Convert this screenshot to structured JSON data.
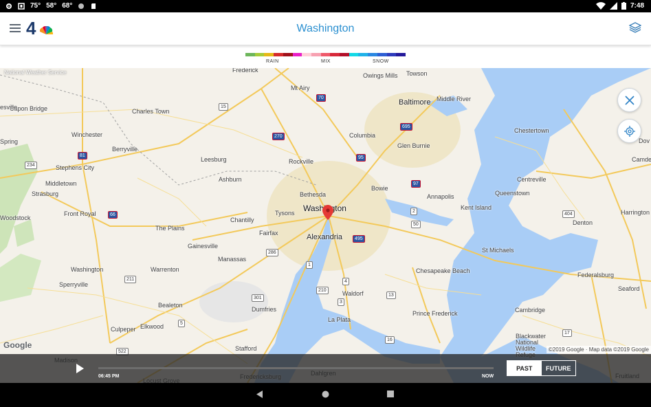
{
  "status_bar": {
    "temps": [
      "75°",
      "58°",
      "68°"
    ],
    "time": "7:48"
  },
  "app_bar": {
    "title": "Washington",
    "logo_text": "4"
  },
  "legend": {
    "labels": [
      "RAIN",
      "MIX",
      "SNOW"
    ],
    "colors": [
      "#6db65b",
      "#a6cc3a",
      "#e6b917",
      "#d52b2b",
      "#a1111b",
      "#e91ec8",
      "#ffd0d8",
      "#f7a1b1",
      "#ef5a6b",
      "#d72839",
      "#b3102a",
      "#12d9e6",
      "#1fb2e8",
      "#2a88e2",
      "#2d5fd4",
      "#2e3cbc",
      "#241a9b"
    ]
  },
  "map": {
    "source_label": "National Weather Service",
    "google_label": "Google",
    "attribution": "©2019 Google · Map data ©2019 Google",
    "places": [
      {
        "name": "Frederick",
        "cls": ""
      },
      {
        "name": "Towson",
        "cls": ""
      },
      {
        "name": "Owings Mills",
        "cls": ""
      },
      {
        "name": "Mt Airy",
        "cls": ""
      },
      {
        "name": "Baltimore",
        "cls": "big"
      },
      {
        "name": "Middle River",
        "cls": ""
      },
      {
        "name": "Capon Bridge",
        "cls": ""
      },
      {
        "name": "Charles Town",
        "cls": ""
      },
      {
        "name": "Chestertown",
        "cls": ""
      },
      {
        "name": "Winchester",
        "cls": ""
      },
      {
        "name": "Columbia",
        "cls": ""
      },
      {
        "name": "Glen Burnie",
        "cls": ""
      },
      {
        "name": "Berryville",
        "cls": ""
      },
      {
        "name": "Leesburg",
        "cls": ""
      },
      {
        "name": "Rockville",
        "cls": ""
      },
      {
        "name": "Stephens City",
        "cls": ""
      },
      {
        "name": "Middletown",
        "cls": ""
      },
      {
        "name": "Ashburn",
        "cls": ""
      },
      {
        "name": "Bowie",
        "cls": ""
      },
      {
        "name": "Centreville",
        "cls": ""
      },
      {
        "name": "Strasburg",
        "cls": ""
      },
      {
        "name": "Bethesda",
        "cls": ""
      },
      {
        "name": "Annapolis",
        "cls": ""
      },
      {
        "name": "Queenstown",
        "cls": ""
      },
      {
        "name": "Washington",
        "cls": "big2"
      },
      {
        "name": "Kent Island",
        "cls": ""
      },
      {
        "name": "Front Royal",
        "cls": ""
      },
      {
        "name": "Tysons",
        "cls": ""
      },
      {
        "name": "Chantilly",
        "cls": ""
      },
      {
        "name": "Denton",
        "cls": ""
      },
      {
        "name": "Harrington",
        "cls": ""
      },
      {
        "name": "Woodstock",
        "cls": ""
      },
      {
        "name": "The Plains",
        "cls": ""
      },
      {
        "name": "Fairfax",
        "cls": ""
      },
      {
        "name": "Alexandria",
        "cls": "big"
      },
      {
        "name": "Gainesville",
        "cls": ""
      },
      {
        "name": "St Michaels",
        "cls": ""
      },
      {
        "name": "Manassas",
        "cls": ""
      },
      {
        "name": "Washington",
        "cls": ""
      },
      {
        "name": "Warrenton",
        "cls": ""
      },
      {
        "name": "Chesapeake Beach",
        "cls": ""
      },
      {
        "name": "Federalsburg",
        "cls": ""
      },
      {
        "name": "Sperryville",
        "cls": ""
      },
      {
        "name": "Waldorf",
        "cls": ""
      },
      {
        "name": "Seaford",
        "cls": ""
      },
      {
        "name": "Bealeton",
        "cls": ""
      },
      {
        "name": "Dumfries",
        "cls": ""
      },
      {
        "name": "Cambridge",
        "cls": ""
      },
      {
        "name": "Prince Frederick",
        "cls": ""
      },
      {
        "name": "La Plata",
        "cls": ""
      },
      {
        "name": "Elkwood",
        "cls": ""
      },
      {
        "name": "Culpeper",
        "cls": ""
      },
      {
        "name": "Blackwater National Wildlife Refuge",
        "cls": ""
      },
      {
        "name": "Stafford",
        "cls": ""
      },
      {
        "name": "Madison",
        "cls": ""
      },
      {
        "name": "Locust Grove",
        "cls": ""
      },
      {
        "name": "Fredericksburg",
        "cls": ""
      },
      {
        "name": "Dahlgren",
        "cls": ""
      },
      {
        "name": "Fruitland",
        "cls": ""
      },
      {
        "name": "Dov",
        "cls": ""
      },
      {
        "name": "Camde",
        "cls": ""
      },
      {
        "name": "Spring",
        "cls": ""
      },
      {
        "name": "esville",
        "cls": ""
      }
    ],
    "route_shields": [
      "15",
      "70",
      "270",
      "695",
      "95",
      "81",
      "97",
      "66",
      "2",
      "50",
      "286",
      "1",
      "495",
      "234",
      "211",
      "210",
      "301",
      "5",
      "404",
      "13",
      "522",
      "3",
      "16",
      "4",
      "17"
    ]
  },
  "player": {
    "start_time": "06:45 PM",
    "end_time": "NOW",
    "past_label": "PAST",
    "future_label": "FUTURE"
  }
}
